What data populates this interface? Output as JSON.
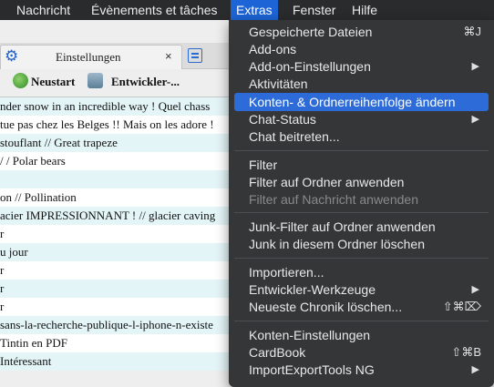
{
  "menubar": {
    "items": [
      "Nachricht",
      "Évènements et tâches",
      "Extras",
      "Fenster",
      "Hilfe"
    ]
  },
  "tab": {
    "label": "Einstellungen",
    "close": "×"
  },
  "toolbar": {
    "restart": "Neustart",
    "developer": "Entwickler-..."
  },
  "messages": [
    "nder snow in an incredible way ! Quel chass",
    "tue pas chez les Belges !! Mais on les adore !",
    "stouflant // Great trapeze",
    " / / Polar bears",
    "",
    "on // Pollination",
    "acier IMPRESSIONNANT ! // glacier caving",
    "r",
    "u jour",
    "r",
    "r",
    "r",
    "sans-la-recherche-publique-l-iphone-n-existe",
    " Tintin en PDF",
    " Intéressant"
  ],
  "menu": {
    "items": [
      {
        "label": "Gespeicherte Dateien",
        "shortcut": "⌘J"
      },
      {
        "label": "Add-ons"
      },
      {
        "label": "Add-on-Einstellungen",
        "submenu": "▶"
      },
      {
        "label": "Aktivitäten"
      },
      {
        "label": "Konten- & Ordnerreihenfolge ändern",
        "highlighted": true
      },
      {
        "label": "Chat-Status",
        "submenu": "▶"
      },
      {
        "label": "Chat beitreten..."
      },
      {
        "label": "Filter"
      },
      {
        "label": "Filter auf Ordner anwenden"
      },
      {
        "label": "Filter auf Nachricht anwenden",
        "disabled": true
      },
      {
        "label": "Junk-Filter auf Ordner anwenden"
      },
      {
        "label": "Junk in diesem Ordner löschen"
      },
      {
        "label": "Importieren..."
      },
      {
        "label": "Entwickler-Werkzeuge",
        "submenu": "▶"
      },
      {
        "label": "Neueste Chronik löschen...",
        "shortcut": "⇧⌘⌦"
      },
      {
        "label": "Konten-Einstellungen"
      },
      {
        "label": "CardBook",
        "shortcut": "⇧⌘B"
      },
      {
        "label": "ImportExportTools NG",
        "submenu": "▶"
      }
    ]
  },
  "colors": {
    "highlight": "#2d6bd8",
    "menu_bg": "#353638",
    "row_alt": "#e4f5f8"
  }
}
